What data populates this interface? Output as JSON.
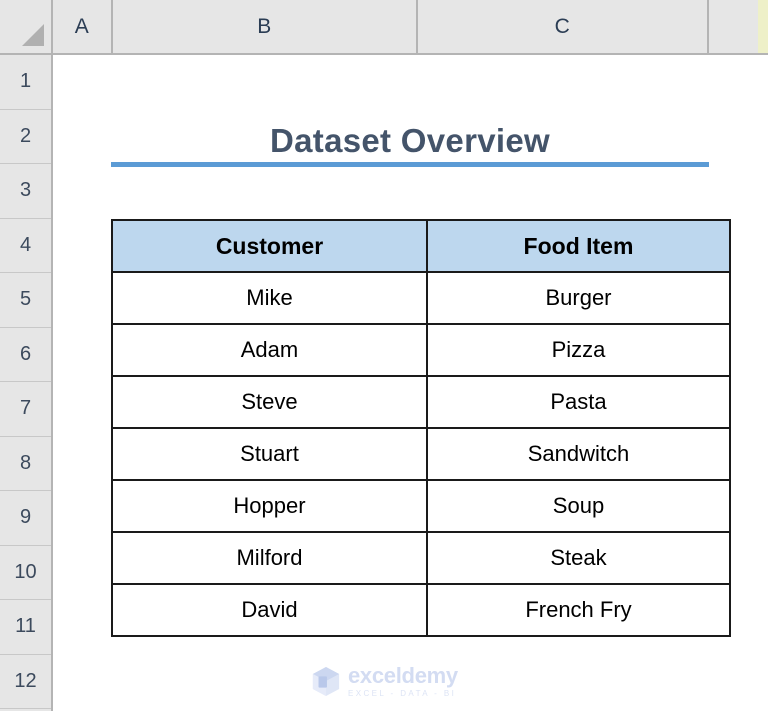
{
  "app": {
    "type": "spreadsheet"
  },
  "grid": {
    "column_headers": [
      "A",
      "B",
      "C"
    ],
    "row_headers": [
      "1",
      "2",
      "3",
      "4",
      "5",
      "6",
      "7",
      "8",
      "9",
      "10",
      "11",
      "12"
    ],
    "select_all_icon": "select-all-triangle-icon"
  },
  "title": {
    "text": "Dataset Overview",
    "color": "#44546A",
    "rule_color": "#5B9BD5"
  },
  "table": {
    "header_fill": "#BDD7EE",
    "border_color": "#000000",
    "columns": [
      "Customer",
      "Food Item"
    ],
    "rows": [
      [
        "Mike",
        "Burger"
      ],
      [
        "Adam",
        "Pizza"
      ],
      [
        "Steve",
        "Pasta"
      ],
      [
        "Stuart",
        "Sandwitch"
      ],
      [
        "Hopper",
        "Soup"
      ],
      [
        "Milford",
        "Steak"
      ],
      [
        "David",
        "French Fry"
      ]
    ]
  },
  "watermark": {
    "name": "exceldemy",
    "tagline": "EXCEL - DATA - BI",
    "logo_icon": "exceldemy-cube-logo-icon",
    "color": "#D3DCF2"
  }
}
